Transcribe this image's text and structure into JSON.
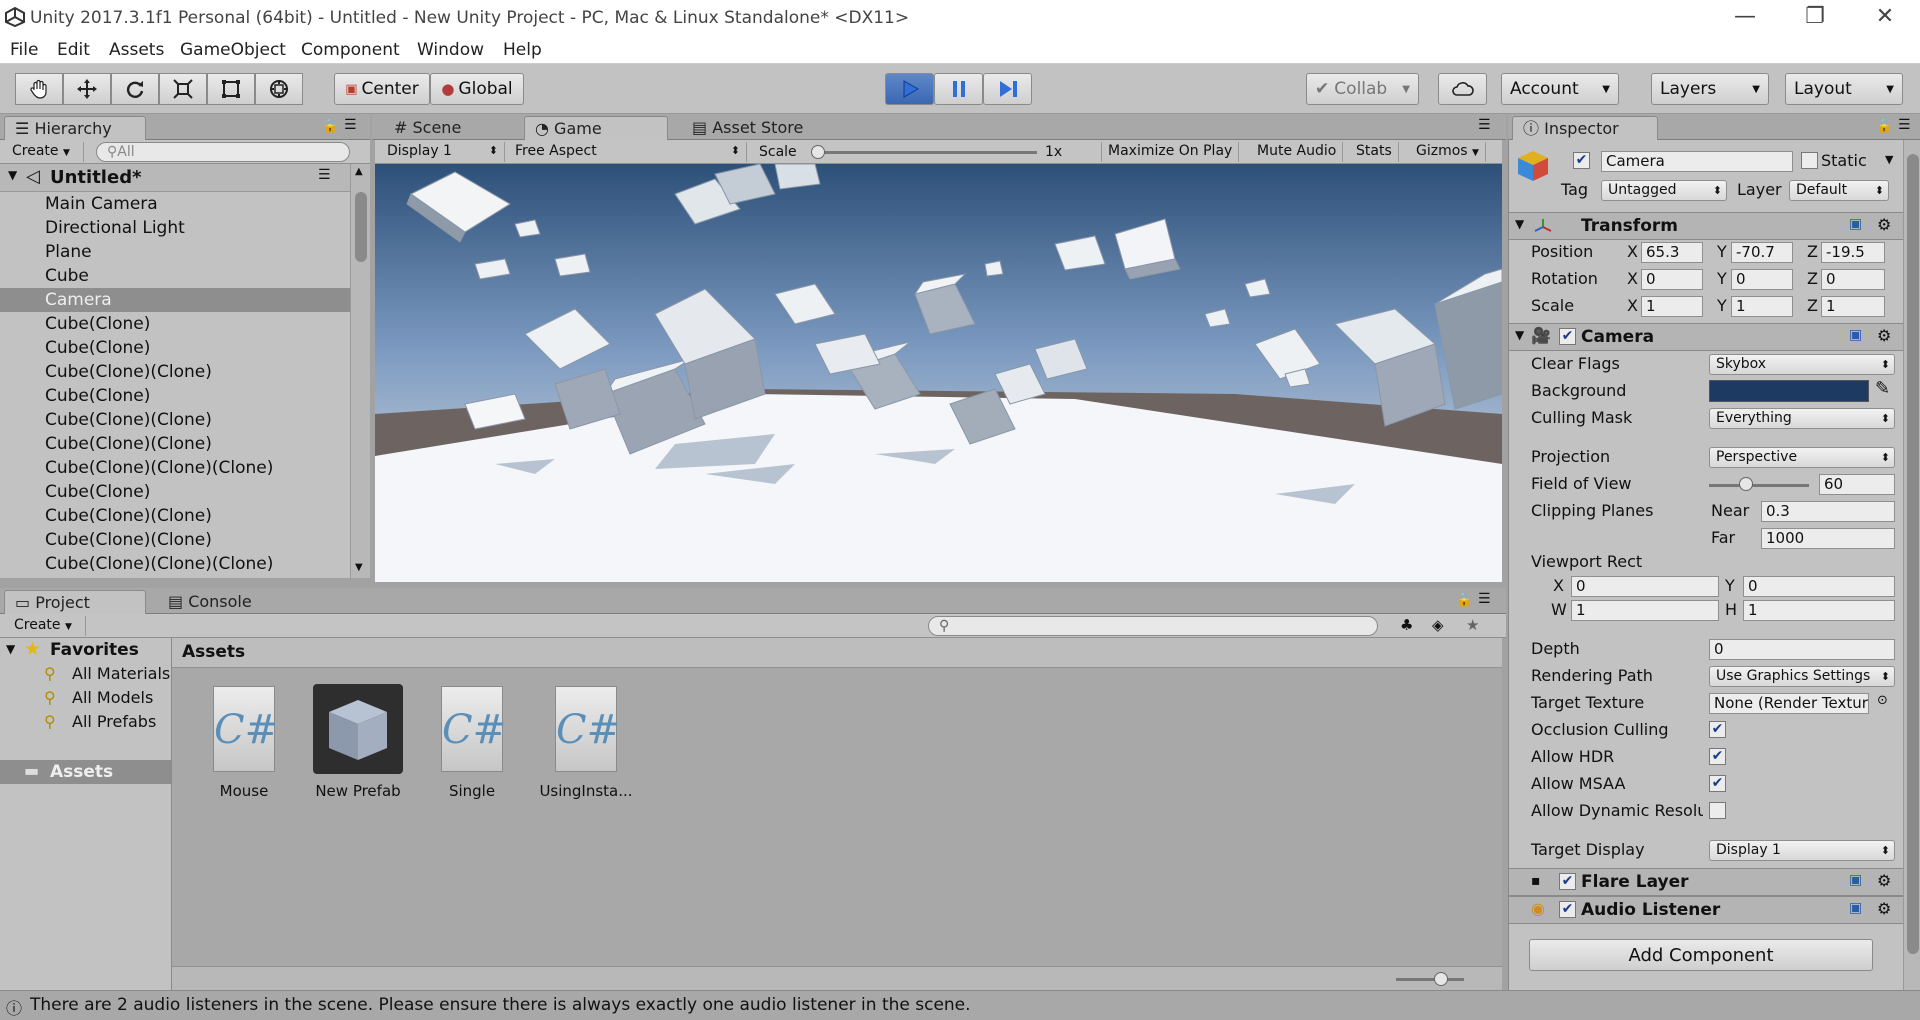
{
  "window": {
    "title": "Unity 2017.3.1f1 Personal (64bit) - Untitled - New Unity Project - PC, Mac & Linux Standalone* <DX11>",
    "controls": [
      "—",
      "❐",
      "✕"
    ]
  },
  "menu": [
    "File",
    "Edit",
    "Assets",
    "GameObject",
    "Component",
    "Window",
    "Help"
  ],
  "toolbar": {
    "pivot": "Center",
    "space": "Global",
    "collab": "Collab",
    "account": "Account",
    "layers": "Layers",
    "layout": "Layout"
  },
  "hierarchy": {
    "tab": "Hierarchy",
    "create": "Create",
    "search_placeholder": "All",
    "scene": "Untitled*",
    "items": [
      "Main Camera",
      "Directional Light",
      "Plane",
      "Cube",
      "Camera",
      "Cube(Clone)",
      "Cube(Clone)",
      "Cube(Clone)(Clone)",
      "Cube(Clone)",
      "Cube(Clone)(Clone)",
      "Cube(Clone)(Clone)",
      "Cube(Clone)(Clone)(Clone)",
      "Cube(Clone)",
      "Cube(Clone)(Clone)",
      "Cube(Clone)(Clone)",
      "Cube(Clone)(Clone)(Clone)"
    ],
    "selected": "Camera"
  },
  "views": {
    "tabs": [
      "Scene",
      "Game",
      "Asset Store"
    ],
    "active": "Game",
    "display": "Display 1",
    "aspect": "Free Aspect",
    "scale_label": "Scale",
    "scale_value": "1x",
    "maximize": "Maximize On Play",
    "mute": "Mute Audio",
    "stats": "Stats",
    "gizmos": "Gizmos"
  },
  "inspector": {
    "tab": "Inspector",
    "object_name": "Camera",
    "static_label": "Static",
    "tag_label": "Tag",
    "tag": "Untagged",
    "layer_label": "Layer",
    "layer": "Default",
    "transform": {
      "title": "Transform",
      "position": {
        "label": "Position",
        "x": "65.3",
        "y": "-70.7",
        "z": "-19.5"
      },
      "rotation": {
        "label": "Rotation",
        "x": "0",
        "y": "0",
        "z": "0"
      },
      "scale": {
        "label": "Scale",
        "x": "1",
        "y": "1",
        "z": "1"
      }
    },
    "camera": {
      "title": "Camera",
      "clear_flags_label": "Clear Flags",
      "clear_flags": "Skybox",
      "background_label": "Background",
      "background_color": "#1d3a63",
      "culling_label": "Culling Mask",
      "culling": "Everything",
      "projection_label": "Projection",
      "projection": "Perspective",
      "fov_label": "Field of View",
      "fov": "60",
      "clipping_label": "Clipping Planes",
      "near_label": "Near",
      "near": "0.3",
      "far_label": "Far",
      "far": "1000",
      "viewport_label": "Viewport Rect",
      "vx": "0",
      "vy": "0",
      "vw": "1",
      "vh": "1",
      "depth_label": "Depth",
      "depth": "0",
      "render_path_label": "Rendering Path",
      "render_path": "Use Graphics Settings",
      "target_texture_label": "Target Texture",
      "target_texture": "None (Render Texture)",
      "occlusion_label": "Occlusion Culling",
      "hdr_label": "Allow HDR",
      "msaa_label": "Allow MSAA",
      "dynres_label": "Allow Dynamic Resolution",
      "target_display_label": "Target Display",
      "target_display": "Display 1"
    },
    "flare": "Flare Layer",
    "audio": "Audio Listener",
    "add_component": "Add Component"
  },
  "project": {
    "tabs": [
      "Project",
      "Console"
    ],
    "create": "Create",
    "favorites": "Favorites",
    "fav_items": [
      "All Materials",
      "All Models",
      "All Prefabs"
    ],
    "assets_folder": "Assets",
    "breadcrumb": "Assets",
    "assets": [
      "Mouse",
      "New Prefab",
      "Single",
      "UsingInsta..."
    ]
  },
  "status": "There are 2 audio listeners in the scene. Please ensure there is always exactly one audio listener in the scene.",
  "colors": {
    "play_accent": "#2f6fd6",
    "selection": "#8e8e8e"
  }
}
